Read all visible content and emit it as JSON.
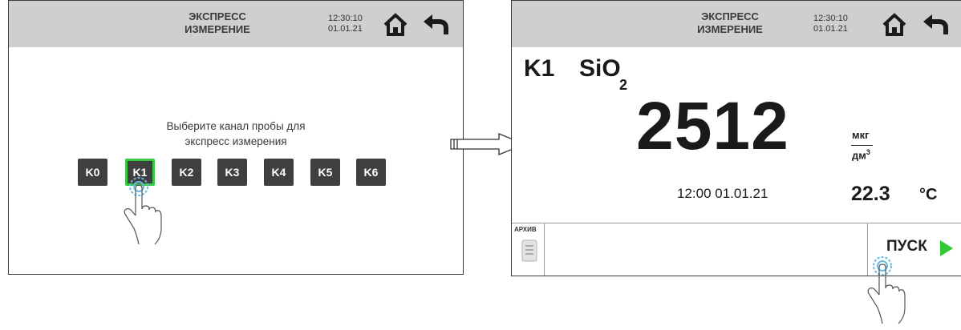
{
  "left_screen": {
    "title_line1": "ЭКСПРЕСС",
    "title_line2": "ИЗМЕРЕНИЕ",
    "time": "12:30:10",
    "date": "01.01.21",
    "prompt_line1": "Выберите канал пробы для",
    "prompt_line2": "экспресс измерения",
    "channels": [
      "K0",
      "K1",
      "K2",
      "K3",
      "K4",
      "K5",
      "K6"
    ],
    "selected_channel": "K1",
    "icons": [
      "home-icon",
      "back-arrow-icon",
      "touch-hand-icon"
    ]
  },
  "right_screen": {
    "title_line1": "ЭКСПРЕСС",
    "title_line2": "ИЗМЕРЕНИЕ",
    "time": "12:30:10",
    "date": "01.01.21",
    "channel": "K1",
    "component": "SiO",
    "component_subscript": "2",
    "value": "2512",
    "unit_numerator": "мкг",
    "unit_denominator": "дм",
    "unit_power": "3",
    "measurement_time": "12:00  01.01.21",
    "temperature": "22.3",
    "temperature_unit": "°C",
    "archive_label": "АРХИВ",
    "start_label": "ПУСК",
    "colors": {
      "start_triangle": "#32c832",
      "title_bar": "#cfcfcf"
    },
    "icons": [
      "home-icon",
      "back-arrow-icon",
      "archive-icon",
      "play-icon",
      "touch-hand-icon"
    ]
  }
}
